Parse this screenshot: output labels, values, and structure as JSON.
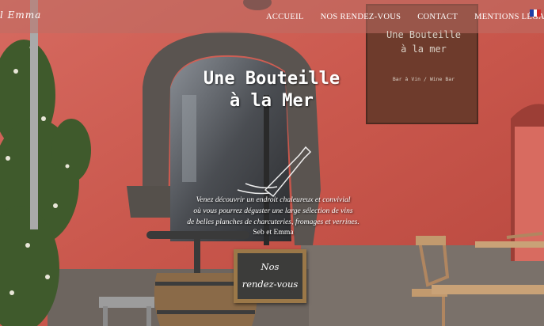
{
  "brand": {
    "text": "l Emma"
  },
  "nav": {
    "items": [
      {
        "label": "ACCUEIL"
      },
      {
        "label": "NOS RENDEZ-VOUS"
      },
      {
        "label": "CONTACT"
      },
      {
        "label": "MENTIONS LÉGALES"
      }
    ],
    "language_flag": "flag-fr-icon"
  },
  "hero": {
    "title_line1": "Une Bouteille",
    "title_line2": "à la Mer",
    "intro_line1": "Venez découvrir un endroit chaleureux et convivial",
    "intro_line2": "où vous pourrez déguster une large sélection de vins",
    "intro_line3": "de belles planches de charcuteries, fromages et verrines.",
    "signature": "Seb et Emma"
  },
  "wall_sign": {
    "line1": "Une Bouteille",
    "line2": "à la mer",
    "line3": "Bar à Vin / Wine Bar"
  },
  "chalkboard": {
    "line1": "Nos",
    "line2": "rendez-vous"
  },
  "colors": {
    "wall": "#c9574c",
    "stone": "#5a5450",
    "sign": "#6e3b2c",
    "accent": "#ffffff"
  }
}
